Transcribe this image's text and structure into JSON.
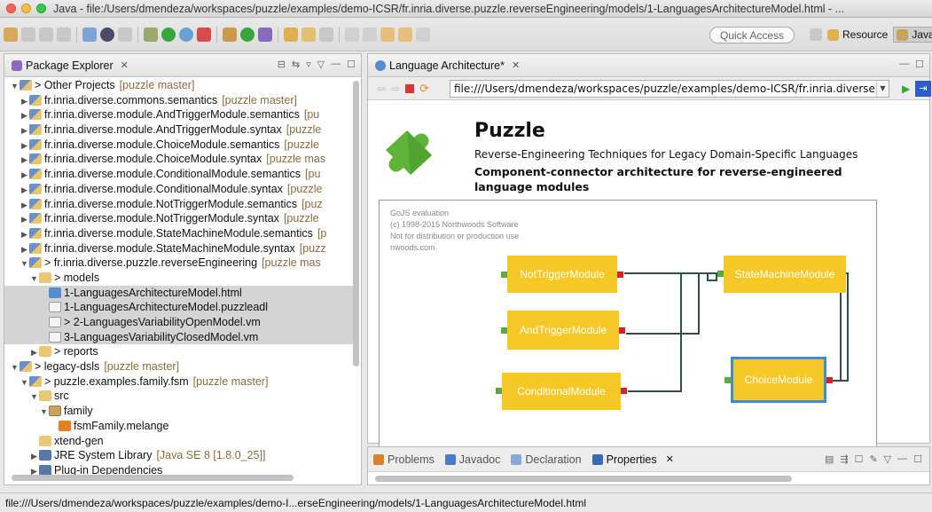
{
  "window": {
    "title": "Java - file:/Users/dmendeza/workspaces/puzzle/examples/demo-ICSR/fr.inria.diverse.puzzle.reverseEngineering/models/1-LanguagesArchitectureModel.html - ..."
  },
  "toolbar": {
    "quick_access": "Quick Access",
    "resource_label": "Resource",
    "java_label": "Java"
  },
  "package_explorer": {
    "tab_title": "Package Explorer",
    "tree": [
      {
        "label": "> Other Projects",
        "deco": "[puzzle master]",
        "indent": 0,
        "twisty": "open",
        "icon": "proj",
        "selected": false
      },
      {
        "label": "fr.inria.diverse.commons.semantics",
        "deco": "[puzzle master]",
        "indent": 1,
        "twisty": "closed",
        "icon": "proj",
        "selected": false
      },
      {
        "label": "fr.inria.diverse.module.AndTriggerModule.semantics",
        "deco": "[pu",
        "indent": 1,
        "twisty": "closed",
        "icon": "proj",
        "selected": false
      },
      {
        "label": "fr.inria.diverse.module.AndTriggerModule.syntax",
        "deco": "[puzzle",
        "indent": 1,
        "twisty": "closed",
        "icon": "proj",
        "selected": false
      },
      {
        "label": "fr.inria.diverse.module.ChoiceModule.semantics",
        "deco": "[puzzle",
        "indent": 1,
        "twisty": "closed",
        "icon": "proj",
        "selected": false
      },
      {
        "label": "fr.inria.diverse.module.ChoiceModule.syntax",
        "deco": "[puzzle mas",
        "indent": 1,
        "twisty": "closed",
        "icon": "proj",
        "selected": false
      },
      {
        "label": "fr.inria.diverse.module.ConditionalModule.semantics",
        "deco": "[pu",
        "indent": 1,
        "twisty": "closed",
        "icon": "proj",
        "selected": false
      },
      {
        "label": "fr.inria.diverse.module.ConditionalModule.syntax",
        "deco": "[puzzle",
        "indent": 1,
        "twisty": "closed",
        "icon": "proj",
        "selected": false
      },
      {
        "label": "fr.inria.diverse.module.NotTriggerModule.semantics",
        "deco": "[puz",
        "indent": 1,
        "twisty": "closed",
        "icon": "proj",
        "selected": false
      },
      {
        "label": "fr.inria.diverse.module.NotTriggerModule.syntax",
        "deco": "[puzzle",
        "indent": 1,
        "twisty": "closed",
        "icon": "proj",
        "selected": false
      },
      {
        "label": "fr.inria.diverse.module.StateMachineModule.semantics",
        "deco": "[p",
        "indent": 1,
        "twisty": "closed",
        "icon": "proj",
        "selected": false
      },
      {
        "label": "fr.inria.diverse.module.StateMachineModule.syntax",
        "deco": "[puzz",
        "indent": 1,
        "twisty": "closed",
        "icon": "proj",
        "selected": false
      },
      {
        "label": "> fr.inria.diverse.puzzle.reverseEngineering",
        "deco": "[puzzle mas",
        "indent": 1,
        "twisty": "open",
        "icon": "proj",
        "selected": false
      },
      {
        "label": "> models",
        "deco": "",
        "indent": 2,
        "twisty": "open",
        "icon": "folder",
        "selected": false
      },
      {
        "label": "1-LanguagesArchitectureModel.html",
        "deco": "",
        "indent": 3,
        "twisty": "none",
        "icon": "html",
        "selected": true
      },
      {
        "label": "1-LanguagesArchitectureModel.puzzleadl",
        "deco": "",
        "indent": 3,
        "twisty": "none",
        "icon": "file",
        "selected": true
      },
      {
        "label": "> 2-LanguagesVariabilityOpenModel.vm",
        "deco": "",
        "indent": 3,
        "twisty": "none",
        "icon": "file",
        "selected": true
      },
      {
        "label": "3-LanguagesVariabilityClosedModel.vm",
        "deco": "",
        "indent": 3,
        "twisty": "none",
        "icon": "file",
        "selected": true
      },
      {
        "label": "> reports",
        "deco": "",
        "indent": 2,
        "twisty": "closed",
        "icon": "folder",
        "selected": false
      },
      {
        "label": "> legacy-dsls",
        "deco": "[puzzle master]",
        "indent": 0,
        "twisty": "open",
        "icon": "proj",
        "selected": false
      },
      {
        "label": "> puzzle.examples.family.fsm",
        "deco": "[puzzle master]",
        "indent": 1,
        "twisty": "open",
        "icon": "proj",
        "selected": false
      },
      {
        "label": "src",
        "deco": "",
        "indent": 2,
        "twisty": "open",
        "icon": "folder",
        "selected": false
      },
      {
        "label": "family",
        "deco": "",
        "indent": 3,
        "twisty": "open",
        "icon": "pkg",
        "selected": false
      },
      {
        "label": "fsmFamily.melange",
        "deco": "",
        "indent": 4,
        "twisty": "none",
        "icon": "melange",
        "selected": false
      },
      {
        "label": "xtend-gen",
        "deco": "",
        "indent": 2,
        "twisty": "none",
        "icon": "folder",
        "selected": false
      },
      {
        "label": "JRE System Library",
        "deco": "[Java SE 8 [1.8.0_25]]",
        "indent": 2,
        "twisty": "closed",
        "icon": "lib",
        "selected": false
      },
      {
        "label": "Plug-in Dependencies",
        "deco": "",
        "indent": 2,
        "twisty": "closed",
        "icon": "lib",
        "selected": false
      }
    ]
  },
  "editor": {
    "tab_title": "Language Architecture*",
    "url": "file:///Users/dmendeza/workspaces/puzzle/examples/demo-ICSR/fr.inria.diverse.pu",
    "page": {
      "title": "Puzzle",
      "subtitle": "Reverse-Engineering Techniques for Legacy Domain-Specific Languages",
      "description": "Component-connector architecture for reverse-engineered language modules"
    },
    "diagram": {
      "watermark": [
        "GoJS evaluation",
        "(c) 1998-2015 Northwoods Software",
        "Not for distribution or production use",
        "nwoods.com"
      ],
      "nodes": {
        "not_trigger": "NotTriggerModule",
        "and_trigger": "AndTriggerModule",
        "conditional": "ConditionalModule",
        "state_machine": "StateMachineModule",
        "choice": "ChoiceModule"
      },
      "colors": {
        "node": "#f5c825",
        "selected_border": "#3a8ddc",
        "input_port": "#5fa83a",
        "output_port": "#d72222",
        "link": "#2f4f4f"
      }
    }
  },
  "bottom_panel": {
    "tabs": [
      "Problems",
      "Javadoc",
      "Declaration",
      "Properties"
    ],
    "active_tab": "Properties"
  },
  "status_bar": {
    "text": "file:///Users/dmendeza/workspaces/puzzle/examples/demo-I...erseEngineering/models/1-LanguagesArchitectureModel.html"
  }
}
